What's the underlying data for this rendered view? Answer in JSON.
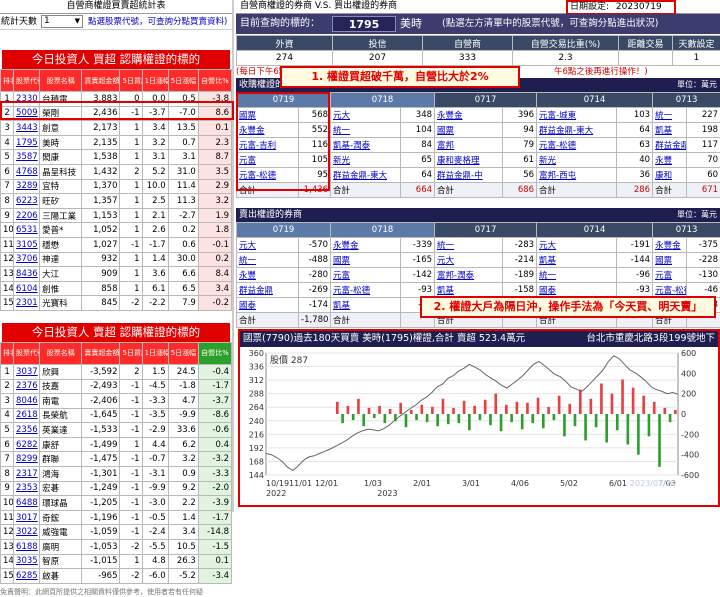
{
  "left": {
    "title": "自營商權證買賣超統計表",
    "days_label": "統計天數",
    "days_value": "1",
    "hint": "點選股票代號，可查詢分點買賣資料)",
    "buy_banner": "今日投資人 買超 認購權證的標的",
    "sell_banner": "今日投資人 賣超 認購權證的標的",
    "headers": [
      "排名",
      "股票代號",
      "股票名稱",
      "買賣超金額(萬)",
      "5日買超天數",
      "1日漲幅",
      "5日漲幅",
      "自營比%"
    ],
    "sell_headers": [
      "排名",
      "股票代號",
      "股票名稱",
      "賣賣超金額(萬)",
      "5日買超天數",
      "1日漲幅",
      "5日漲幅",
      "自營比%"
    ],
    "buy_rows": [
      [
        "1",
        "2330",
        "台積電",
        "3,883",
        "0",
        "0.0",
        "0.5",
        "-3.8"
      ],
      [
        "2",
        "5009",
        "榮剛",
        "2,436",
        "-1",
        "-3.7",
        "-7.0",
        "8.6"
      ],
      [
        "3",
        "3443",
        "創意",
        "2,173",
        "1",
        "3.4",
        "13.5",
        "0.1"
      ],
      [
        "4",
        "1795",
        "美時",
        "2,135",
        "1",
        "3.2",
        "0.7",
        "2.3"
      ],
      [
        "5",
        "3587",
        "閎康",
        "1,538",
        "1",
        "3.1",
        "3.1",
        "8.7"
      ],
      [
        "6",
        "4768",
        "晶呈科技",
        "1,432",
        "2",
        "5.2",
        "31.0",
        "3.5"
      ],
      [
        "7",
        "3289",
        "宜特",
        "1,370",
        "1",
        "10.0",
        "11.4",
        "2.9"
      ],
      [
        "8",
        "6223",
        "旺矽",
        "1,357",
        "1",
        "2.5",
        "11.3",
        "3.2"
      ],
      [
        "9",
        "2206",
        "三陽工業",
        "1,153",
        "1",
        "2.1",
        "-2.7",
        "1.9"
      ],
      [
        "10",
        "6531",
        "愛普*",
        "1,052",
        "1",
        "2.6",
        "0.2",
        "1.8"
      ],
      [
        "11",
        "3105",
        "穩懋",
        "1,027",
        "-1",
        "-1.7",
        "0.6",
        "-0.1"
      ],
      [
        "12",
        "3706",
        "神達",
        "932",
        "1",
        "1.4",
        "30.0",
        "0.2"
      ],
      [
        "13",
        "8436",
        "大江",
        "909",
        "1",
        "3.6",
        "6.6",
        "8.4"
      ],
      [
        "14",
        "6104",
        "創惟",
        "858",
        "1",
        "6.1",
        "6.5",
        "3.4"
      ],
      [
        "15",
        "2301",
        "光寶科",
        "845",
        "-2",
        "-2.2",
        "7.9",
        "-0.2"
      ]
    ],
    "sell_rows": [
      [
        "1",
        "3037",
        "欣興",
        "-3,592",
        "2",
        "1.5",
        "24.5",
        "-0.4"
      ],
      [
        "2",
        "2376",
        "技嘉",
        "-2,493",
        "-1",
        "-4.5",
        "-1.8",
        "-1.7"
      ],
      [
        "3",
        "8046",
        "南電",
        "-2,406",
        "-1",
        "-3.3",
        "4.7",
        "-3.7"
      ],
      [
        "4",
        "2618",
        "長榮航",
        "-1,645",
        "-1",
        "-3.5",
        "-9.9",
        "-8.6"
      ],
      [
        "5",
        "2356",
        "英業達",
        "-1,533",
        "-1",
        "-2.9",
        "33.6",
        "-0.6"
      ],
      [
        "6",
        "6282",
        "康舒",
        "-1,499",
        "1",
        "4.4",
        "6.2",
        "0.4"
      ],
      [
        "7",
        "8299",
        "群聯",
        "-1,475",
        "-1",
        "-0.7",
        "3.2",
        "-3.2"
      ],
      [
        "8",
        "2317",
        "鴻海",
        "-1,301",
        "-1",
        "-3.1",
        "0.9",
        "-3.3"
      ],
      [
        "9",
        "2353",
        "宏碁",
        "-1,249",
        "-1",
        "-9.9",
        "9.2",
        "-2.0"
      ],
      [
        "10",
        "6488",
        "環球晶",
        "-1,205",
        "-1",
        "-3.0",
        "2.2",
        "-3.9"
      ],
      [
        "11",
        "3017",
        "奇鋐",
        "-1,196",
        "-1",
        "-0.5",
        "1.4",
        "-1.7"
      ],
      [
        "12",
        "3022",
        "威強電",
        "-1,059",
        "-1",
        "-2.4",
        "3.4",
        "-14.8"
      ],
      [
        "13",
        "6188",
        "廣明",
        "-1,053",
        "-2",
        "-5.5",
        "10.5",
        "-1.5"
      ],
      [
        "14",
        "3035",
        "智原",
        "-1,015",
        "1",
        "4.8",
        "26.3",
        "0.1"
      ],
      [
        "15",
        "6285",
        "啟碁",
        "-965",
        "-2",
        "-6.0",
        "-5.2",
        "-3.4"
      ]
    ],
    "footer": "免責聲明：此網頁所提供之相關資料僅供參考，使用者若有任何疑"
  },
  "right": {
    "title": "自營商權證的券商 V.S. 買出權證的券商",
    "date_label": "日期設定:",
    "date_value": "20230719",
    "target_label": "目前查詢的標的：",
    "stock_code": "1795",
    "stock_name": "美時",
    "target_hint": "(點選左方清單中的股票代號，可查詢分點進出狀況)",
    "summary_headers": [
      "外資",
      "投信",
      "自營商",
      "自營交易比重(%)",
      "距離交易",
      "天數設定"
    ],
    "summary_values": [
      "274",
      "207",
      "333",
      "2.3",
      "",
      "1"
    ],
    "note": "(每日下午6點後更新)",
    "note2": "午6點之後再進行操作！)",
    "buy_section": "收購權證的券商",
    "unit": "單位：萬元",
    "dates": [
      "0719",
      "0718",
      "0717",
      "0714",
      "0713"
    ],
    "buy_rows": [
      [
        [
          "國票",
          "568"
        ],
        [
          "元大",
          "348"
        ],
        [
          "永豐金",
          "396"
        ],
        [
          "元富-城東",
          "103"
        ],
        [
          "統一",
          "227"
        ]
      ],
      [
        [
          "永豐金",
          "552"
        ],
        [
          "統一",
          "104"
        ],
        [
          "國票",
          "94"
        ],
        [
          "群益金鼎-東大",
          "64"
        ],
        [
          "凱基",
          "198"
        ]
      ],
      [
        [
          "元富-吉利",
          "116"
        ],
        [
          "凱基-潤泰",
          "84"
        ],
        [
          "富邦",
          "79"
        ],
        [
          "元富-松德",
          "63"
        ],
        [
          "群益金鼎",
          "117"
        ]
      ],
      [
        [
          "元富",
          "105"
        ],
        [
          "新光",
          "65"
        ],
        [
          "康和麥格理",
          "61"
        ],
        [
          "新光",
          "40"
        ],
        [
          "永豐",
          "70"
        ]
      ],
      [
        [
          "元富-松德",
          "95"
        ],
        [
          "群益金鼎-東大",
          "64"
        ],
        [
          "群益金鼎-中",
          "56"
        ],
        [
          "富邦-西屯",
          "36"
        ],
        [
          "康和",
          "60"
        ]
      ]
    ],
    "buy_sums": [
      "1,436",
      "664",
      "686",
      "286",
      "671"
    ],
    "sell_section": "賣出權證的券商",
    "sell_rows": [
      [
        [
          "元大",
          "-570"
        ],
        [
          "永豐金",
          "-339"
        ],
        [
          "統一",
          "-283"
        ],
        [
          "元大",
          "-191"
        ],
        [
          "永豐金",
          "-375"
        ]
      ],
      [
        [
          "統一",
          "-488"
        ],
        [
          "國票",
          "-165"
        ],
        [
          "元大",
          "-214"
        ],
        [
          "凱基",
          "-144"
        ],
        [
          "國票",
          "-228"
        ]
      ],
      [
        [
          "永豐",
          "-280"
        ],
        [
          "元富",
          "-142"
        ],
        [
          "富邦-潤泰",
          "-189"
        ],
        [
          "統一",
          "-96"
        ],
        [
          "元富",
          "-130"
        ]
      ],
      [
        [
          "群益金鼎",
          "-269"
        ],
        [
          "元富-松德",
          "-93"
        ],
        [
          "凱基",
          "-158"
        ],
        [
          "國泰",
          "-93"
        ],
        [
          "元富-松德",
          "-46"
        ]
      ],
      [
        [
          "國泰",
          "-174"
        ],
        [
          "凱基",
          "-91"
        ],
        [
          "群益金鼎",
          "-135"
        ],
        [
          "永豐金",
          "-78"
        ],
        [
          "第一金",
          "-43"
        ]
      ]
    ],
    "sell_sums": [
      "-1,780",
      "",
      "",
      "",
      ""
    ],
    "sum_label": "合計",
    "callout1": "1. 權證買超破千萬，自營比大於2%",
    "callout2": "2. 權證大戶為隔日沖，操作手法為「今天買、明天賣」",
    "chart_select": "7790",
    "chart_select_suffix": "國票",
    "chart_header": "國票(7790)過去180天買賣 美時(1795)權證,合計 賣超 523.4萬元",
    "chart_location": "台北市重慶北路3段199號地下",
    "legend": "股價 287",
    "watermark": "2023/07/20"
  },
  "colors": {
    "accent_red": "#e00000",
    "header_navy": "#1e1e50",
    "bar_red": "#e64040",
    "bar_green": "#2ca02c"
  },
  "chart_data": {
    "type": "bar",
    "title": "國票(7790)過去180天買賣 美時(1795)權證,合計 賣超 523.4萬元",
    "x_ticks": [
      "10/19",
      "11/01",
      "12/01",
      "1/03",
      "2/01",
      "3/01",
      "4/06",
      "5/02",
      "6/01",
      "7/03"
    ],
    "x_tick_labels": [
      "10/1911/01",
      "12/01",
      "1/03",
      "2/01",
      "3/01",
      "4/06",
      "5/02",
      "6/01",
      "7/03"
    ],
    "years": [
      "2022",
      "2023"
    ],
    "left_axis": {
      "ticks": [
        144,
        168,
        192,
        216,
        240,
        264,
        288,
        312,
        336,
        360
      ],
      "range": [
        144,
        360
      ]
    },
    "right_axis": {
      "ticks": [
        600,
        400,
        200,
        0,
        -200,
        -400,
        -600
      ],
      "range": [
        -600,
        600
      ]
    },
    "legend": "股價 287",
    "price_series": [
      182,
      180,
      175,
      168,
      158,
      152,
      160,
      170,
      176,
      178,
      182,
      186,
      190,
      195,
      200,
      205,
      212,
      218,
      222,
      225,
      224,
      222,
      226,
      232,
      240,
      248,
      255,
      262,
      268,
      276,
      282,
      290,
      300,
      305,
      315,
      320,
      328,
      333,
      340,
      335,
      330,
      322,
      316,
      310,
      303,
      298,
      305,
      312,
      320,
      330,
      340,
      345,
      338,
      330,
      322,
      318,
      310,
      300,
      296,
      292,
      300,
      310,
      320,
      330,
      345,
      355,
      350,
      340,
      330,
      325,
      318,
      310,
      300,
      295,
      292,
      288,
      290,
      287
    ],
    "bar_series": [
      0,
      0,
      0,
      0,
      0,
      0,
      0,
      0,
      0,
      0,
      0,
      0,
      0,
      120,
      -90,
      80,
      -60,
      150,
      -120,
      60,
      -40,
      80,
      -90,
      50,
      -70,
      110,
      -130,
      40,
      -60,
      90,
      -80,
      70,
      -120,
      150,
      -100,
      60,
      -90,
      130,
      -160,
      80,
      -60,
      140,
      -110,
      200,
      -170,
      90,
      -80,
      120,
      -150,
      110,
      -90,
      160,
      -140,
      70,
      -60,
      180,
      -220,
      100,
      -120,
      240,
      -260,
      150,
      -130,
      300,
      -280,
      200,
      -160,
      340,
      -300,
      260,
      -400,
      180,
      -220,
      120,
      -520,
      60,
      -80,
      40
    ]
  }
}
